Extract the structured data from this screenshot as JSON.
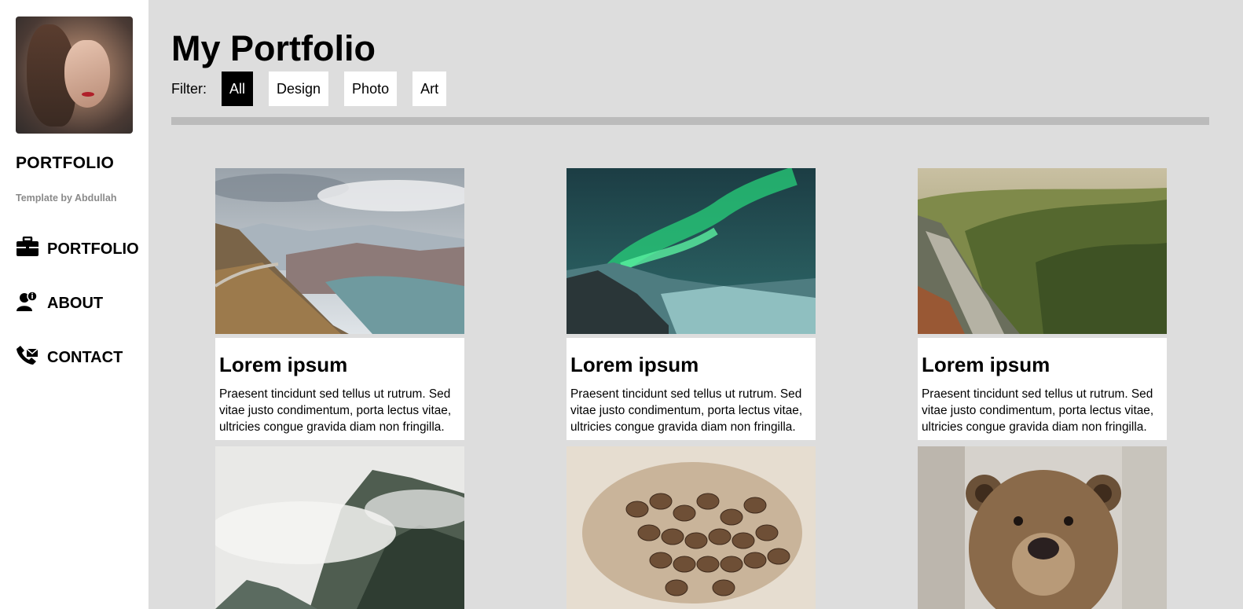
{
  "sidebar": {
    "brand": "PORTFOLIO",
    "byline": "Template by Abdullah",
    "items": [
      {
        "label": "PORTFOLIO",
        "icon": "briefcase-icon"
      },
      {
        "label": "ABOUT",
        "icon": "user-info-icon"
      },
      {
        "label": "CONTACT",
        "icon": "phone-icon"
      }
    ]
  },
  "main": {
    "title": "My Portfolio",
    "filter_label": "Filter:",
    "filters": [
      {
        "label": "All",
        "active": true
      },
      {
        "label": "Design",
        "active": false
      },
      {
        "label": "Photo",
        "active": false
      },
      {
        "label": "Art",
        "active": false
      }
    ],
    "cards": [
      {
        "title": "Lorem ipsum",
        "text": "Praesent tincidunt sed tellus ut rutrum. Sed vitae justo condimentum, porta lectus vitae, ultricies congue gravida diam non fringilla.",
        "image": "mountain-lake-road"
      },
      {
        "title": "Lorem ipsum",
        "text": "Praesent tincidunt sed tellus ut rutrum. Sed vitae justo condimentum, porta lectus vitae, ultricies congue gravida diam non fringilla.",
        "image": "northern-lights"
      },
      {
        "title": "Lorem ipsum",
        "text": "Praesent tincidunt sed tellus ut rutrum. Sed vitae justo condimentum, porta lectus vitae, ultricies congue gravida diam non fringilla.",
        "image": "forest-valley-waterfall"
      }
    ],
    "tiles": [
      "misty-mountain",
      "coffee-beans",
      "brown-bear"
    ]
  }
}
